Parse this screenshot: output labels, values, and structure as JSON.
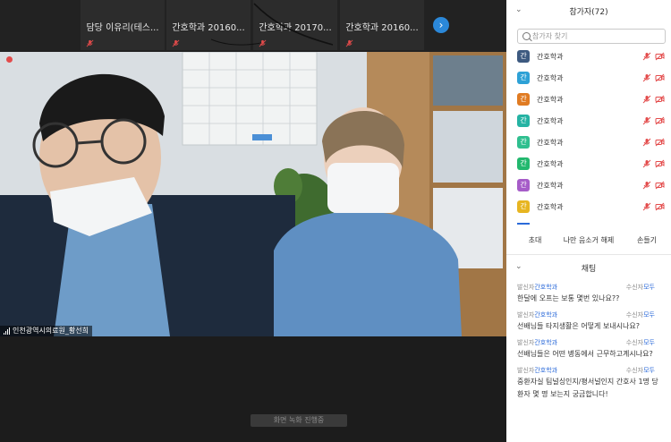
{
  "thumbnails": [
    {
      "name": "담당 이유리(테스..."
    },
    {
      "name": "간호학과 20160..."
    },
    {
      "name": "간호학과 20170..."
    },
    {
      "name": "간호학과 20160..."
    }
  ],
  "main_video": {
    "speaker_name": "인천광역시의료원_황선희"
  },
  "overlay_text": "화면 녹화 진행중",
  "participants_panel": {
    "title": "참가자(72)",
    "search_placeholder": "참가자 찾기",
    "participants": [
      {
        "avatar": "간",
        "name": "간호학과",
        "color": "#3d5a80"
      },
      {
        "avatar": "간",
        "name": "간호학과",
        "color": "#2ea1d6"
      },
      {
        "avatar": "간",
        "name": "간호학과",
        "color": "#e07b22"
      },
      {
        "avatar": "간",
        "name": "간호학과",
        "color": "#25b3a3"
      },
      {
        "avatar": "간",
        "name": "간호학과",
        "color": "#2fbf8f"
      },
      {
        "avatar": "간",
        "name": "간호학과",
        "color": "#22b86e"
      },
      {
        "avatar": "간",
        "name": "간호학과",
        "color": "#a65cc8"
      },
      {
        "avatar": "간",
        "name": "간호학과",
        "color": "#e7b521"
      }
    ],
    "buttons": {
      "invite": "초대",
      "unmute": "나만 음소거 해제",
      "raise_hand": "손들기"
    }
  },
  "chat_panel": {
    "title": "채팅",
    "sender_label": "발신자",
    "receiver_label": "수신자",
    "messages": [
      {
        "from": "간호학과",
        "to": "모두",
        "text": "한달에 오프는 보통 몇번 있나요??"
      },
      {
        "from": "간호학과",
        "to": "모두",
        "text": "선배님들 타지생활은 어떻게 보내시나요?"
      },
      {
        "from": "간호학과",
        "to": "모두",
        "text": "선배님들은 어떤 병동에서 근무하고계시나요?"
      },
      {
        "from": "간호학과",
        "to": "모두",
        "text": "중환자실 팀널싱인지/평서널인지 간호사 1명 당 환자 몇 명 보는지 궁금합니다!"
      }
    ]
  },
  "colors": {
    "accent_blue": "#2b6ad9",
    "muted_red": "#e34b4b"
  }
}
